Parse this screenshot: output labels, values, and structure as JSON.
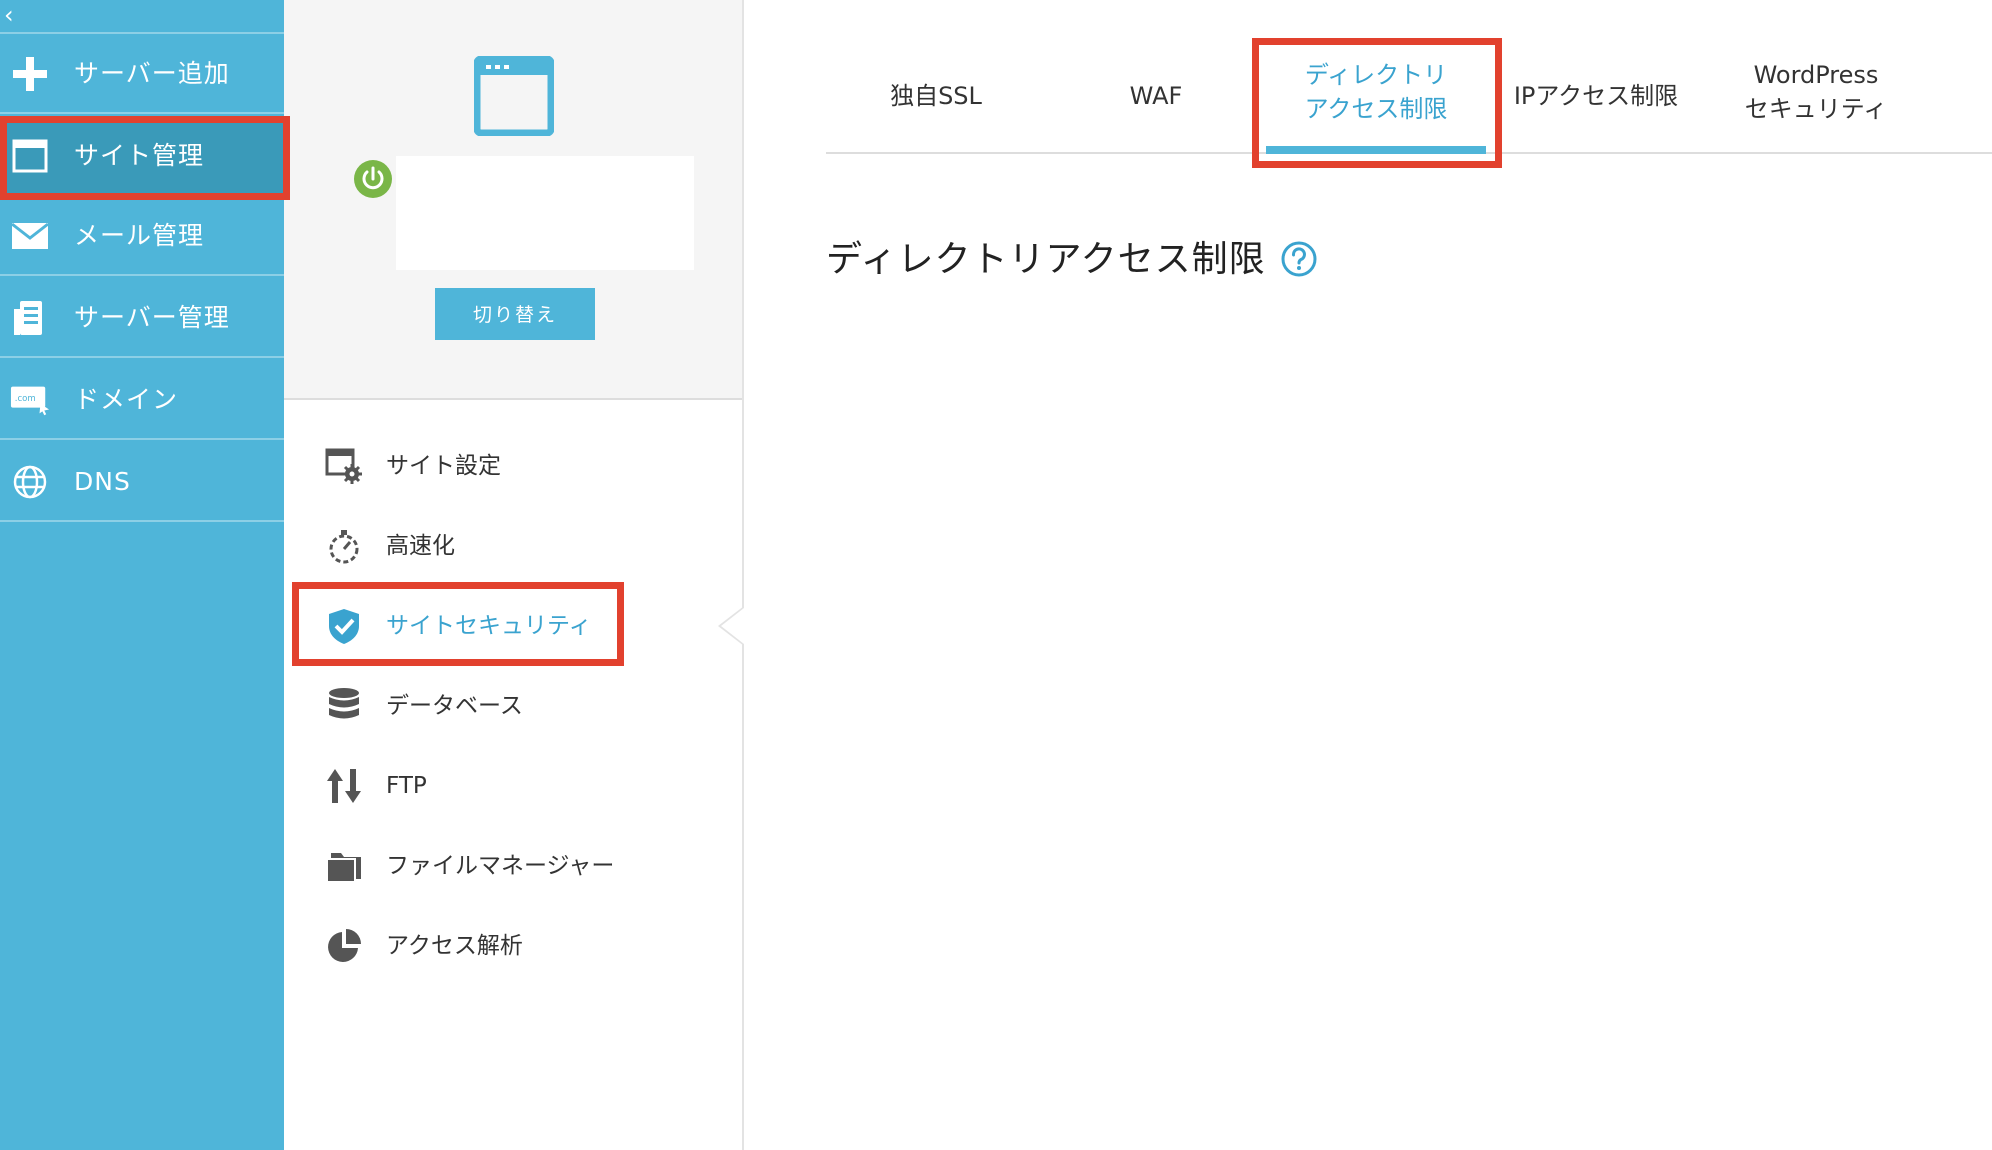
{
  "left_nav": {
    "collapse_icon": "chevron-left-icon",
    "items": [
      {
        "label": "サーバー追加",
        "icon": "plus-icon"
      },
      {
        "label": "サイト管理",
        "icon": "window-icon"
      },
      {
        "label": "メール管理",
        "icon": "mail-icon"
      },
      {
        "label": "サーバー管理",
        "icon": "server-icon"
      },
      {
        "label": "ドメイン",
        "icon": "domain-icon"
      },
      {
        "label": "DNS",
        "icon": "globe-icon"
      }
    ],
    "active_index": 1
  },
  "site_card": {
    "window_icon": "browser-window-icon",
    "power_icon": "power-icon",
    "site_name": "",
    "switch_button_label": "切り替え"
  },
  "site_menu": {
    "items": [
      {
        "label": "サイト設定",
        "icon": "site-settings-icon"
      },
      {
        "label": "高速化",
        "icon": "stopwatch-icon"
      },
      {
        "label": "サイトセキュリティ",
        "icon": "shield-check-icon"
      },
      {
        "label": "データベース",
        "icon": "database-icon"
      },
      {
        "label": "FTP",
        "icon": "transfer-arrows-icon"
      },
      {
        "label": "ファイルマネージャー",
        "icon": "folder-icon"
      },
      {
        "label": "アクセス解析",
        "icon": "pie-chart-icon"
      }
    ],
    "active_index": 2
  },
  "tabs": {
    "items": [
      {
        "line1": "独自SSL",
        "line2": ""
      },
      {
        "line1": "WAF",
        "line2": ""
      },
      {
        "line1": "ディレクトリ",
        "line2": "アクセス制限"
      },
      {
        "line1": "IPアクセス制限",
        "line2": ""
      },
      {
        "line1": "WordPress",
        "line2": "セキュリティ"
      }
    ],
    "active_index": 2
  },
  "content": {
    "title": "ディレクトリアクセス制限",
    "help_icon": "question-circle-icon"
  },
  "colors": {
    "nav_blue": "#4fb5d9",
    "nav_active": "#3a9ab9",
    "accent_text": "#3aa3cf",
    "highlight_red": "#e2412e",
    "power_green": "#7ab648"
  }
}
